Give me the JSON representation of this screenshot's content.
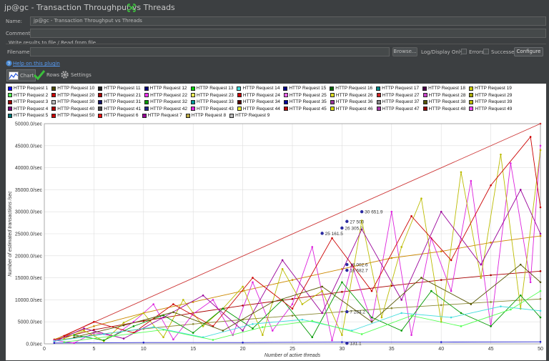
{
  "window": {
    "title": "jp@gc - Transaction Throughput vs Threads"
  },
  "form": {
    "name_label": "Name:",
    "name_value": "jp@gc - Transaction Throughput vs Threads",
    "comments_label": "Comments:",
    "comments_value": "",
    "write_results_label": "Write results to file / Read from file",
    "filename_label": "Filename",
    "filename_value": "",
    "browse_label": "Browse...",
    "log_display_label": "Log/Display Only:",
    "errors_label": "Errors",
    "successes_label": "Successes",
    "configure_label": "Configure",
    "help_link": "Help on this plugin"
  },
  "tabs": [
    {
      "label": "Chart",
      "icon": "chart-icon",
      "active": true
    },
    {
      "label": "Rows",
      "icon": "checkmark-icon",
      "active": false
    },
    {
      "label": "Settings",
      "icon": "gear-icon",
      "active": false
    }
  ],
  "chart_data": {
    "type": "line",
    "xlabel": "Number of active threads",
    "ylabel": "Number of estimated transactions /sec",
    "xlim": [
      0,
      50
    ],
    "ylim": [
      0,
      50000
    ],
    "xticks": [
      "0",
      "5",
      "10",
      "15",
      "20",
      "25",
      "30",
      "35",
      "40",
      "45",
      "50"
    ],
    "yticks": [
      "0.0/sec",
      "5000.0/sec",
      "10000.0/sec",
      "15000.0/sec",
      "20000.0/sec",
      "25000.0/sec",
      "30000.0/sec",
      "35000.0/sec",
      "40000.0/sec",
      "45000.0/sec",
      "50000.0/sec"
    ],
    "legend": [
      {
        "name": "HTTP Request 1",
        "color": "#0000ff"
      },
      {
        "name": "HTTP Request 10",
        "color": "#4b4b00"
      },
      {
        "name": "HTTP Request 11",
        "color": "#222222"
      },
      {
        "name": "HTTP Request 12",
        "color": "#00007a"
      },
      {
        "name": "HTTP Request 13",
        "color": "#00cc00"
      },
      {
        "name": "HTTP Request 14",
        "color": "#44dddd"
      },
      {
        "name": "HTTP Request 15",
        "color": "#000088"
      },
      {
        "name": "HTTP Request 16",
        "color": "#006600"
      },
      {
        "name": "HTTP Request 17",
        "color": "#008888"
      },
      {
        "name": "HTTP Request 18",
        "color": "#4a004a"
      },
      {
        "name": "HTTP Request 19",
        "color": "#cccc00"
      },
      {
        "name": "HTTP Request 2",
        "color": "#55ff55"
      },
      {
        "name": "HTTP Request 20",
        "color": "#cc0000"
      },
      {
        "name": "HTTP Request 21",
        "color": "#aa0000"
      },
      {
        "name": "HTTP Request 22",
        "color": "#ff33ff"
      },
      {
        "name": "HTTP Request 23",
        "color": "#ffff55"
      },
      {
        "name": "HTTP Request 24",
        "color": "#cc0000"
      },
      {
        "name": "HTTP Request 25",
        "color": "#ff66ff"
      },
      {
        "name": "HTTP Request 26",
        "color": "#dddd22"
      },
      {
        "name": "HTTP Request 27",
        "color": "#cc2222"
      },
      {
        "name": "HTTP Request 28",
        "color": "#cc44cc"
      },
      {
        "name": "HTTP Request 29",
        "color": "#aaaa00"
      },
      {
        "name": "HTTP Request 3",
        "color": "#990000"
      },
      {
        "name": "HTTP Request 30",
        "color": "#bbbbbb"
      },
      {
        "name": "HTTP Request 31",
        "color": "#111166"
      },
      {
        "name": "HTTP Request 32",
        "color": "#009900"
      },
      {
        "name": "HTTP Request 33",
        "color": "#009999"
      },
      {
        "name": "HTTP Request 34",
        "color": "#550000"
      },
      {
        "name": "HTTP Request 35",
        "color": "#000099"
      },
      {
        "name": "HTTP Request 36",
        "color": "#993399"
      },
      {
        "name": "HTTP Request 37",
        "color": "#888888"
      },
      {
        "name": "HTTP Request 38",
        "color": "#555500"
      },
      {
        "name": "HTTP Request 39",
        "color": "#bbbb00"
      },
      {
        "name": "HTTP Request 4",
        "color": "#770077"
      },
      {
        "name": "HTTP Request 40",
        "color": "#aa0000"
      },
      {
        "name": "HTTP Request 41",
        "color": "#444444"
      },
      {
        "name": "HTTP Request 42",
        "color": "#222288"
      },
      {
        "name": "HTTP Request 43",
        "color": "#dd22dd"
      },
      {
        "name": "HTTP Request 44",
        "color": "#eeee33"
      },
      {
        "name": "HTTP Request 45",
        "color": "#bb0000"
      },
      {
        "name": "HTTP Request 46",
        "color": "#dddd00"
      },
      {
        "name": "HTTP Request 47",
        "color": "#aa33aa"
      },
      {
        "name": "HTTP Request 48",
        "color": "#990000"
      },
      {
        "name": "HTTP Request 49",
        "color": "#ff44ff"
      },
      {
        "name": "HTTP Request 5",
        "color": "#007777"
      },
      {
        "name": "HTTP Request 50",
        "color": "#cc0000"
      },
      {
        "name": "HTTP Request 6",
        "color": "#ee1111"
      },
      {
        "name": "HTTP Request 7",
        "color": "#990099"
      },
      {
        "name": "HTTP Request 8",
        "color": "#bbaa44"
      },
      {
        "name": "HTTP Request 9",
        "color": "#bbbbbb"
      }
    ],
    "series": [
      {
        "color": "#cc3333",
        "x": [
          1,
          50
        ],
        "y": [
          900,
          50000
        ]
      },
      {
        "color": "#cc8800",
        "x": [
          1,
          5,
          10,
          15,
          20,
          25,
          30,
          35,
          40,
          45,
          50
        ],
        "y": [
          1000,
          4000,
          7000,
          9500,
          12000,
          14500,
          17000,
          19500,
          21000,
          23000,
          24500
        ]
      },
      {
        "color": "#aa0000",
        "x": [
          1,
          5,
          10,
          15,
          20,
          25,
          30,
          35,
          40,
          45,
          50
        ],
        "y": [
          900,
          3200,
          5200,
          7000,
          8700,
          10200,
          11800,
          13200,
          14500,
          15600,
          16500
        ]
      },
      {
        "color": "#888833",
        "x": [
          1,
          5,
          10,
          15,
          20,
          25,
          30,
          35,
          40,
          45,
          50
        ],
        "y": [
          700,
          2000,
          3400,
          4500,
          5500,
          6400,
          7300,
          8100,
          8800,
          9500,
          10200
        ]
      },
      {
        "color": "#2222cc",
        "x": [
          1,
          10,
          20,
          30,
          40,
          50
        ],
        "y": [
          200,
          300,
          300,
          400,
          400,
          450
        ]
      },
      {
        "color": "#dd22dd",
        "x": [
          1,
          3,
          5,
          7,
          9,
          11,
          13,
          15,
          17,
          19,
          21,
          23,
          25,
          27,
          29,
          31,
          33,
          35,
          37,
          39,
          41,
          43,
          45,
          47,
          49,
          50
        ],
        "y": [
          800,
          200,
          2500,
          1800,
          5000,
          9000,
          1000,
          6800,
          10000,
          2000,
          14000,
          3000,
          9000,
          22000,
          800,
          18000,
          5000,
          30000,
          2000,
          24000,
          12000,
          37000,
          4000,
          41000,
          14000,
          45000
        ]
      },
      {
        "color": "#bbbb00",
        "x": [
          2,
          4,
          6,
          8,
          10,
          12,
          14,
          16,
          18,
          20,
          22,
          24,
          26,
          28,
          30,
          32,
          34,
          36,
          38,
          40,
          42,
          44,
          46,
          48,
          50
        ],
        "y": [
          1200,
          3000,
          600,
          4800,
          7000,
          1500,
          10000,
          4000,
          8000,
          13000,
          2000,
          17000,
          9000,
          12000,
          2000,
          28000,
          6000,
          22000,
          33000,
          5000,
          39000,
          15000,
          43000,
          8000,
          44000
        ]
      },
      {
        "color": "#009900",
        "x": [
          3,
          6,
          9,
          12,
          15,
          18,
          21,
          24,
          27,
          30,
          33,
          36,
          39,
          42,
          45,
          48,
          50
        ],
        "y": [
          2000,
          800,
          4000,
          6500,
          2500,
          8000,
          3500,
          10000,
          1500,
          14000,
          6000,
          3000,
          12000,
          7000,
          4000,
          11000,
          6000
        ]
      },
      {
        "color": "#990099",
        "x": [
          1,
          4,
          8,
          12,
          16,
          20,
          24,
          28,
          32,
          36,
          40,
          44,
          48,
          50
        ],
        "y": [
          500,
          3500,
          1200,
          6000,
          11000,
          3000,
          19000,
          7000,
          26000,
          10000,
          30000,
          18000,
          35000,
          25000
        ]
      },
      {
        "color": "#cc0000",
        "x": [
          2,
          5,
          9,
          13,
          17,
          21,
          25,
          29,
          33,
          37,
          41,
          45,
          49,
          50
        ],
        "y": [
          1800,
          5000,
          2500,
          9000,
          4000,
          15000,
          8000,
          24000,
          12000,
          29000,
          19000,
          36000,
          47000,
          31000
        ]
      },
      {
        "color": "#44dddd",
        "x": [
          1,
          6,
          11,
          16,
          21,
          26,
          31,
          36,
          41,
          46,
          50
        ],
        "y": [
          600,
          2200,
          3800,
          1500,
          4500,
          5500,
          3000,
          7000,
          6000,
          8500,
          7500
        ]
      },
      {
        "color": "#55ff55",
        "x": [
          2,
          7,
          12,
          17,
          22,
          27,
          32,
          37,
          42,
          47,
          50
        ],
        "y": [
          400,
          1800,
          3200,
          900,
          3800,
          5200,
          2200,
          6400,
          4000,
          7800,
          12000
        ]
      },
      {
        "color": "#555500",
        "x": [
          3,
          8,
          13,
          18,
          23,
          28,
          33,
          38,
          43,
          48,
          50
        ],
        "y": [
          1500,
          4200,
          7200,
          3000,
          9500,
          13000,
          5000,
          15000,
          9000,
          18000,
          14000
        ]
      }
    ],
    "annotations": [
      {
        "text": "30 651.9",
        "x": 32,
        "y": 30000
      },
      {
        "text": "27 500",
        "x": 30.5,
        "y": 27800
      },
      {
        "text": "26 305.2",
        "x": 30,
        "y": 26300
      },
      {
        "text": "25 161.5",
        "x": 28,
        "y": 25100
      },
      {
        "text": "18 002.6",
        "x": 30.5,
        "y": 18000
      },
      {
        "text": "16 682.7",
        "x": 30.5,
        "y": 16700
      },
      {
        "text": "7 284.2",
        "x": 30.5,
        "y": 7300
      },
      {
        "text": "131.1",
        "x": 30.5,
        "y": 131
      }
    ]
  }
}
